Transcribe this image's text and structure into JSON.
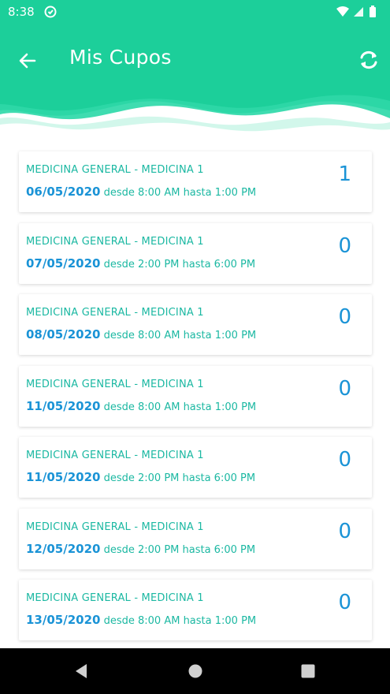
{
  "status_bar": {
    "time": "8:38"
  },
  "header": {
    "title": "Mis Cupos",
    "color_primary": "#1ccf9a",
    "color_secondary": "#3dd9ac"
  },
  "colors": {
    "specialty_text": "#1bb8a2",
    "date_text": "#1a93d6",
    "count_text": "#1a93d6"
  },
  "cupos": [
    {
      "specialty": "MEDICINA GENERAL - MEDICINA 1",
      "date": "06/05/2020",
      "range": "desde 8:00 AM hasta 1:00 PM",
      "count": "1"
    },
    {
      "specialty": "MEDICINA GENERAL - MEDICINA 1",
      "date": "07/05/2020",
      "range": "desde 2:00 PM hasta 6:00 PM",
      "count": "0"
    },
    {
      "specialty": "MEDICINA GENERAL - MEDICINA 1",
      "date": "08/05/2020",
      "range": "desde 8:00 AM hasta 1:00 PM",
      "count": "0"
    },
    {
      "specialty": "MEDICINA GENERAL - MEDICINA 1",
      "date": "11/05/2020",
      "range": "desde 8:00 AM hasta 1:00 PM",
      "count": "0"
    },
    {
      "specialty": "MEDICINA GENERAL - MEDICINA 1",
      "date": "11/05/2020",
      "range": "desde 2:00 PM hasta 6:00 PM",
      "count": "0"
    },
    {
      "specialty": "MEDICINA GENERAL - MEDICINA 1",
      "date": "12/05/2020",
      "range": "desde 2:00 PM hasta 6:00 PM",
      "count": "0"
    },
    {
      "specialty": "MEDICINA GENERAL - MEDICINA 1",
      "date": "13/05/2020",
      "range": "desde 8:00 AM hasta 1:00 PM",
      "count": "0"
    }
  ],
  "icons": {
    "back": "arrow-left-icon",
    "refresh": "refresh-icon",
    "app_status": "app-notification-icon",
    "wifi": "wifi-icon",
    "signal": "signal-icon",
    "battery": "battery-icon",
    "nav_back": "nav-back-icon",
    "nav_home": "nav-home-icon",
    "nav_recents": "nav-recents-icon"
  }
}
